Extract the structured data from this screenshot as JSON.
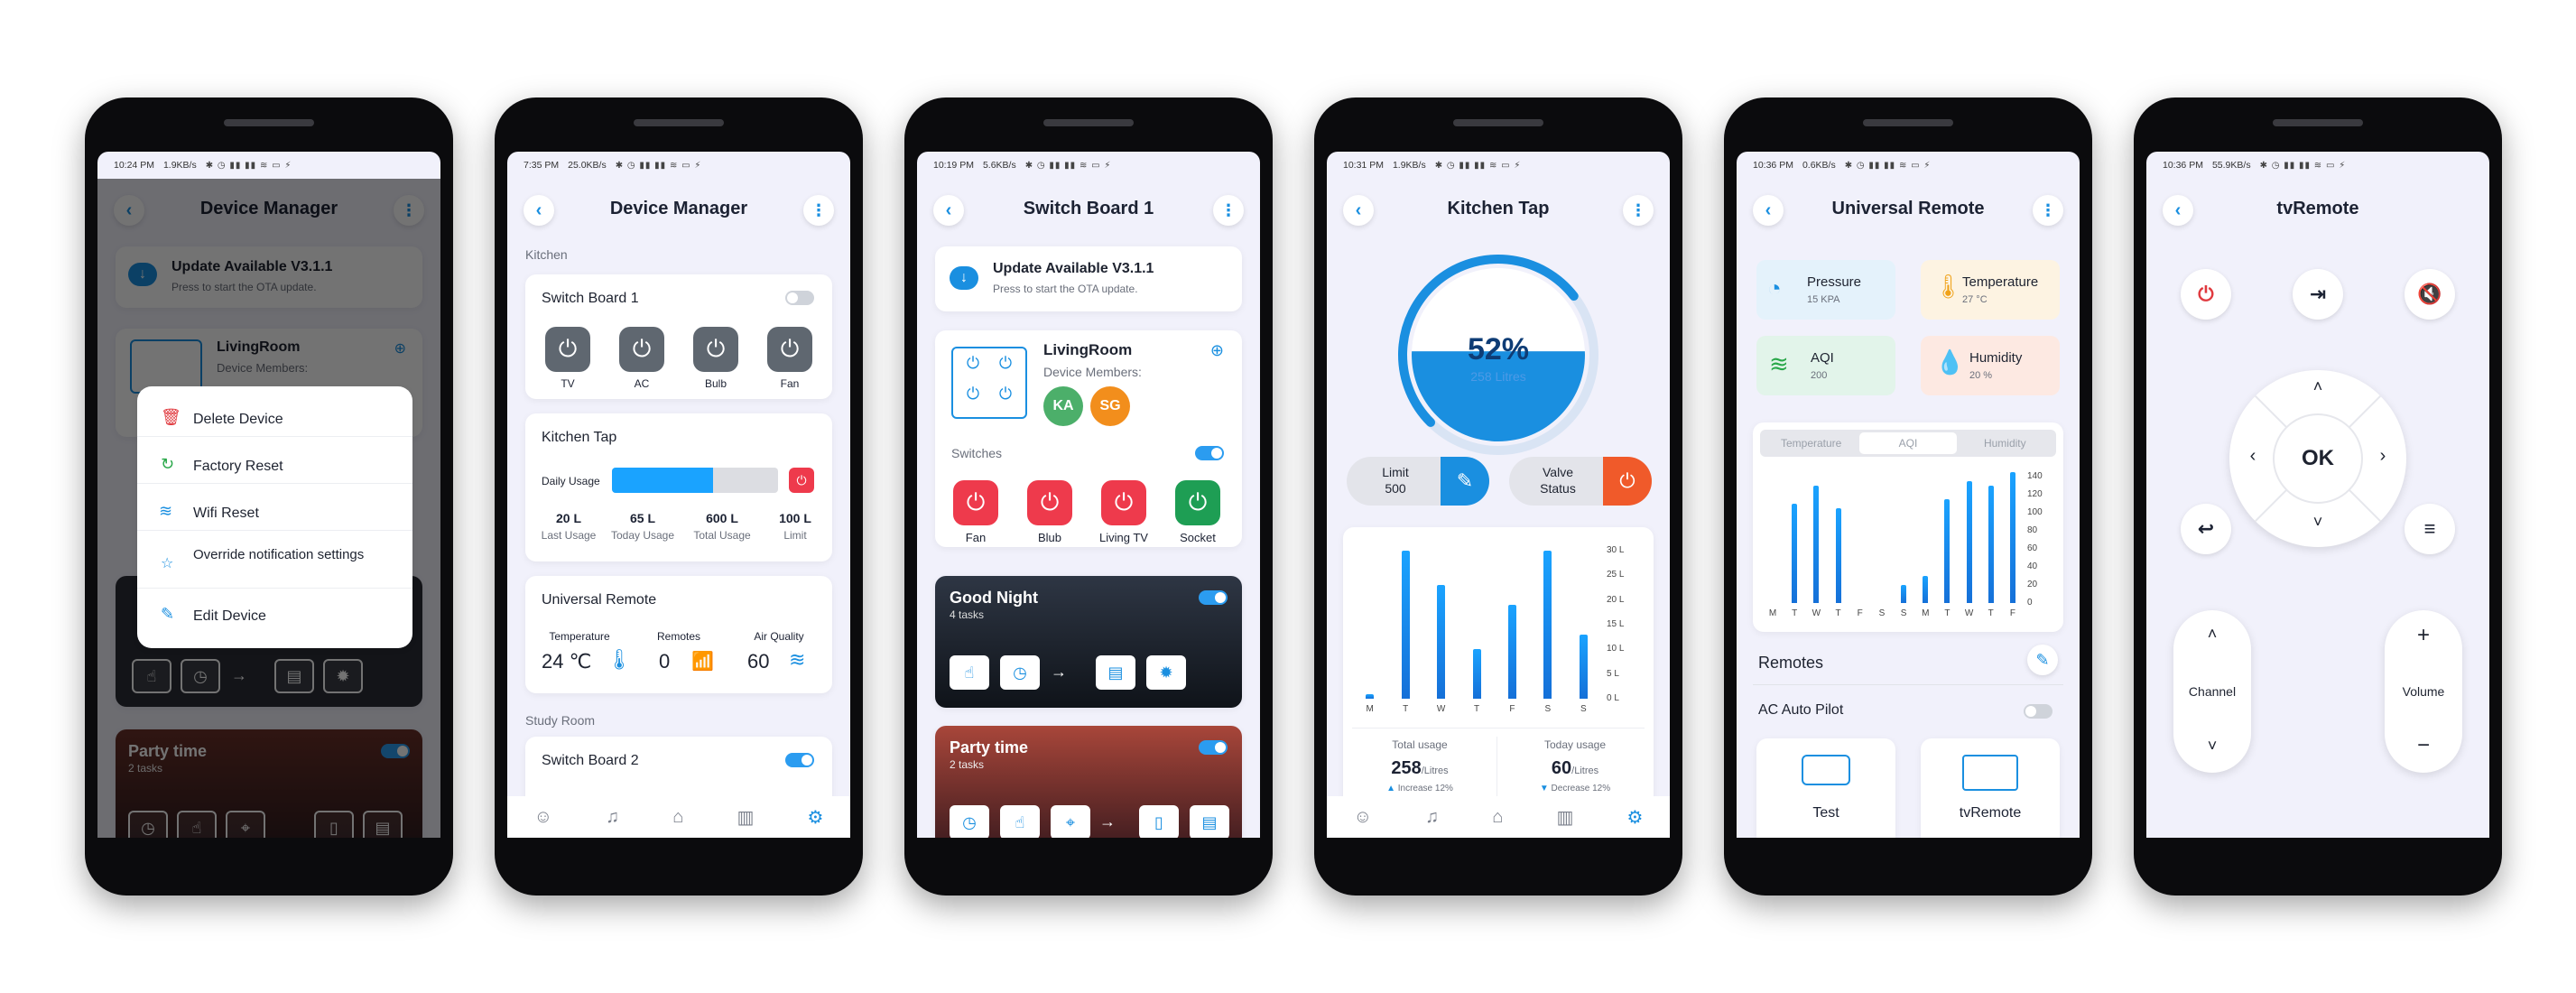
{
  "status_times": [
    "10:24 PM",
    "7:35 PM",
    "10:19 PM",
    "10:31 PM",
    "10:36 PM",
    "10:36 PM"
  ],
  "status_speeds": [
    "1.9KB/s",
    "25.0KB/s",
    "5.6KB/s",
    "1.9KB/s",
    "0.6KB/s",
    "55.9KB/s"
  ],
  "status_icons": "✱ ◷ ▮▮ ▮▮ ≋ ▭ ⚡",
  "titles": {
    "dm": "Device Manager",
    "sb": "Switch Board 1",
    "kt": "Kitchen Tap",
    "ur": "Universal Remote",
    "tv": "tvRemote"
  },
  "update": {
    "title": "Update Available V3.1.1",
    "sub": "Press to start the OTA update."
  },
  "room": {
    "name": "LivingRoom",
    "members_label": "Device Members:",
    "members": [
      "KA",
      "SG"
    ],
    "members_short": "Device Members:"
  },
  "menu": [
    "Delete Device",
    "Factory Reset",
    "Wifi Reset",
    "Override notification settings",
    "Edit Device"
  ],
  "menu_icons": [
    "trash-icon",
    "reset-icon",
    "wifi-icon",
    "bell-icon",
    "pencil-icon"
  ],
  "party": {
    "title": "Party time",
    "tasks": "2 tasks"
  },
  "goodnight": {
    "title": "Good Night",
    "tasks": "4 tasks"
  },
  "dm": {
    "kitchen": "Kitchen",
    "sb1": "Switch Board 1",
    "sb1_devices": [
      "TV",
      "AC",
      "Bulb",
      "Fan"
    ],
    "tap": "Kitchen Tap",
    "daily": "Daily Usage",
    "daily_fill": 0.61,
    "usage": [
      {
        "v": "20 L",
        "l": "Last Usage"
      },
      {
        "v": "65 L",
        "l": "Today Usage"
      },
      {
        "v": "600 L",
        "l": "Total Usage"
      },
      {
        "v": "100 L",
        "l": "Limit"
      }
    ],
    "ur": "Universal Remote",
    "ur_stats": [
      {
        "l": "Temperature",
        "v": "24 ℃"
      },
      {
        "l": "Remotes",
        "v": "0"
      },
      {
        "l": "Air Quality",
        "v": "60"
      }
    ],
    "study": "Study Room",
    "sb2": "Switch Board 2"
  },
  "sb": {
    "switches": "Switches",
    "devices": [
      "Fan",
      "Blub",
      "Living TV",
      "Socket"
    ]
  },
  "kt": {
    "percent": "52%",
    "litres": "258 Litres",
    "fill": 0.52,
    "limit_l": "Limit",
    "limit_v": "500",
    "valve_l": "Valve",
    "valve_v": "Status",
    "chart": {
      "x": [
        "M",
        "T",
        "W",
        "T",
        "F",
        "S",
        "S"
      ],
      "values": [
        1,
        30,
        23,
        10,
        19,
        30,
        13
      ],
      "yticks": [
        "30 L",
        "25 L",
        "20 L",
        "15 L",
        "10 L",
        "5 L",
        "0 L"
      ],
      "ymax": 30
    },
    "total_l": "Total usage",
    "total_v": "258",
    "total_u": "Litres",
    "total_d": "Increase 12%",
    "today_l": "Today usage",
    "today_v": "60",
    "today_u": "Litres",
    "today_d": "Decrease 12%"
  },
  "ur": {
    "tiles": [
      {
        "t": "Pressure",
        "v": "15 KPA"
      },
      {
        "t": "Temperature",
        "v": "27 °C"
      },
      {
        "t": "AQI",
        "v": "200"
      },
      {
        "t": "Humidity",
        "v": "20 %"
      }
    ],
    "tabs": [
      "Temperature",
      "AQI",
      "Humidity"
    ],
    "chart": {
      "x": [
        "M",
        "T",
        "W",
        "T",
        "F",
        "S",
        "S",
        "M",
        "T",
        "W",
        "T",
        "F"
      ],
      "values": [
        0,
        110,
        130,
        105,
        0,
        0,
        20,
        30,
        115,
        135,
        130,
        145
      ],
      "yticks": [
        "140",
        "120",
        "100",
        "80",
        "60",
        "40",
        "20",
        "0"
      ],
      "ymax": 140
    },
    "remotes": "Remotes",
    "autopilot": "AC Auto Pilot",
    "cards": [
      "Test",
      "tvRemote"
    ]
  },
  "tv": {
    "ok": "OK",
    "channel": "Channel",
    "volume": "Volume",
    "plus": "+",
    "minus": "−"
  }
}
